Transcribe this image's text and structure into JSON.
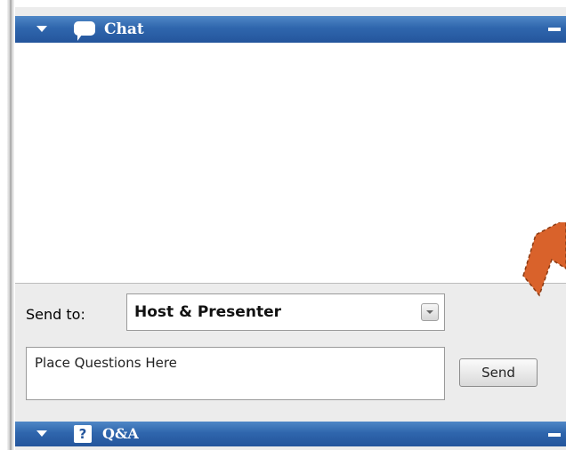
{
  "chat_panel": {
    "title": "Chat",
    "icon": "speech-bubble-icon"
  },
  "send_to": {
    "label": "Send to:",
    "selected": "Host & Presenter"
  },
  "message_input": {
    "value": "Place Questions Here"
  },
  "send_button": {
    "label": "Send"
  },
  "qa_panel": {
    "title": "Q&A",
    "icon": "question-icon",
    "icon_glyph": "?"
  },
  "colors": {
    "header_blue": "#2f66ad",
    "annotation_arrow": "#d9622b"
  }
}
